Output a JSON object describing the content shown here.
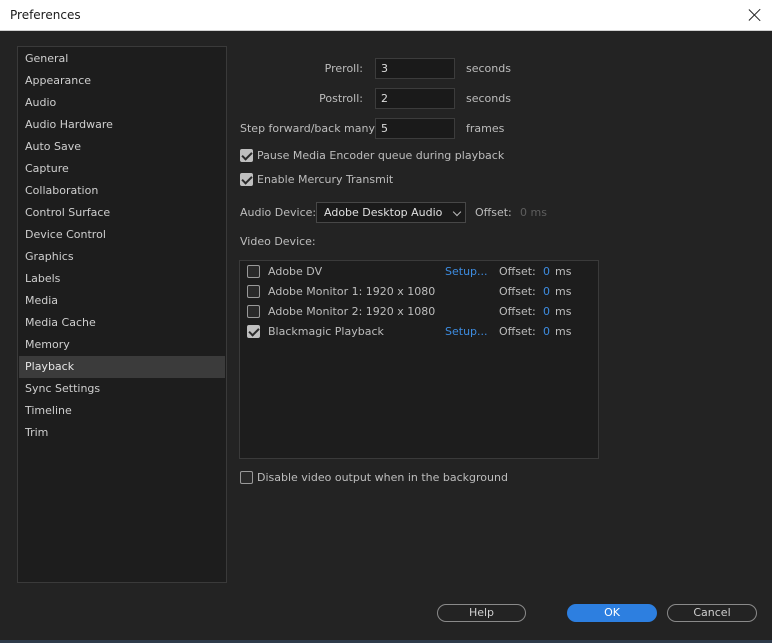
{
  "window": {
    "title": "Preferences"
  },
  "sidebar": {
    "items": [
      {
        "label": "General"
      },
      {
        "label": "Appearance"
      },
      {
        "label": "Audio"
      },
      {
        "label": "Audio Hardware"
      },
      {
        "label": "Auto Save"
      },
      {
        "label": "Capture"
      },
      {
        "label": "Collaboration"
      },
      {
        "label": "Control Surface"
      },
      {
        "label": "Device Control"
      },
      {
        "label": "Graphics"
      },
      {
        "label": "Labels"
      },
      {
        "label": "Media"
      },
      {
        "label": "Media Cache"
      },
      {
        "label": "Memory"
      },
      {
        "label": "Playback"
      },
      {
        "label": "Sync Settings"
      },
      {
        "label": "Timeline"
      },
      {
        "label": "Trim"
      }
    ],
    "selected": "Playback"
  },
  "playback": {
    "preroll": {
      "label": "Preroll:",
      "value": "3",
      "unit": "seconds"
    },
    "postroll": {
      "label": "Postroll:",
      "value": "2",
      "unit": "seconds"
    },
    "step": {
      "label": "Step forward/back many:",
      "value": "5",
      "unit": "frames"
    },
    "pause_encoder": {
      "label": "Pause Media Encoder queue during playback",
      "checked": true
    },
    "mercury": {
      "label": "Enable Mercury Transmit",
      "checked": true
    },
    "audio_device": {
      "label": "Audio Device:",
      "value": "Adobe Desktop Audio",
      "offset_label": "Offset:",
      "offset_value": "0 ms"
    },
    "video_device": {
      "label": "Video Device:",
      "devices": [
        {
          "name": "Adobe DV",
          "checked": false,
          "setup": "Setup...",
          "offset_label": "Offset:",
          "offset": "0",
          "unit": "ms"
        },
        {
          "name": "Adobe Monitor 1: 1920 x 1080",
          "checked": false,
          "setup": "",
          "offset_label": "Offset:",
          "offset": "0",
          "unit": "ms"
        },
        {
          "name": "Adobe Monitor 2: 1920 x 1080",
          "checked": false,
          "setup": "",
          "offset_label": "Offset:",
          "offset": "0",
          "unit": "ms"
        },
        {
          "name": "Blackmagic Playback",
          "checked": true,
          "setup": "Setup...",
          "offset_label": "Offset:",
          "offset": "0",
          "unit": "ms"
        }
      ]
    },
    "disable_background": {
      "label": "Disable video output when in the background",
      "checked": false
    }
  },
  "buttons": {
    "help": "Help",
    "ok": "OK",
    "cancel": "Cancel"
  },
  "colors": {
    "accent": "#2d7fe0",
    "link": "#3d8ce0",
    "background": "#232323"
  }
}
